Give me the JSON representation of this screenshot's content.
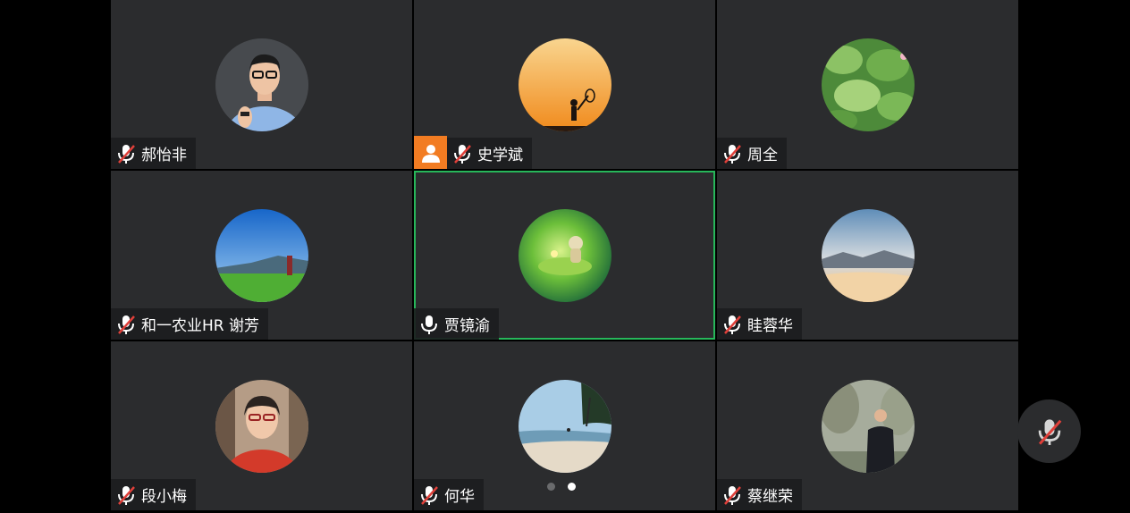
{
  "participants": [
    {
      "name": "郝怡非",
      "mic": "muted",
      "avatar_theme": "man-portrait"
    },
    {
      "name": "史学斌",
      "mic": "muted",
      "host": true,
      "avatar_theme": "sunset-silhouette"
    },
    {
      "name": "周全",
      "mic": "muted",
      "avatar_theme": "lotus-leaves"
    },
    {
      "name": "和一农业HR 谢芳",
      "mic": "muted",
      "avatar_theme": "grassland-sky"
    },
    {
      "name": "贾镜渝",
      "mic": "on",
      "active_speaker": true,
      "avatar_theme": "anime-forest"
    },
    {
      "name": "眭蓉华",
      "mic": "muted",
      "avatar_theme": "misty-mountains"
    },
    {
      "name": "段小梅",
      "mic": "muted",
      "avatar_theme": "woman-portrait"
    },
    {
      "name": "何华",
      "mic": "muted",
      "avatar_theme": "beach-palms"
    },
    {
      "name": "蔡继荣",
      "mic": "muted",
      "avatar_theme": "man-outdoor"
    }
  ],
  "pagination": {
    "pages": 2,
    "current": 2
  },
  "self_mic": {
    "state": "muted",
    "icon": "mic-muted-icon"
  },
  "colors": {
    "tile_bg": "#2b2c2e",
    "active_border": "#27b75a",
    "host_badge": "#f27c22",
    "muted_slash": "#e0403a"
  }
}
